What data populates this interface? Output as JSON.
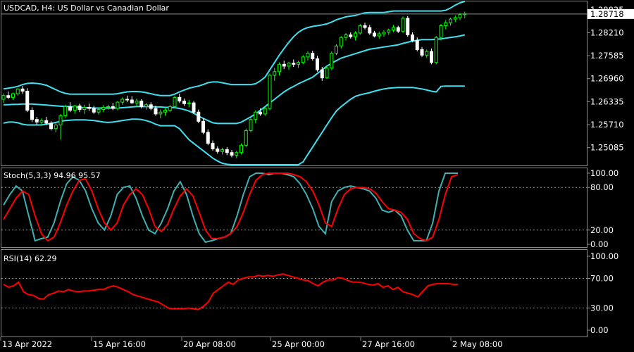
{
  "window": {
    "title": "USDCAD, H4:  US Dollar vs Canadian Dollar",
    "symbol": "USDCAD",
    "timeframe": "H4",
    "description": "US Dollar vs Canadian Dollar"
  },
  "colors": {
    "background": "#000000",
    "grid": "#8a8a8a",
    "bull_candle": "#00ff00",
    "bear_candle": "#ffffff",
    "bands": "#40e0f0",
    "stoch_main": "#40b0b0",
    "stoch_signal": "#ff0000",
    "rsi": "#ff0000",
    "price_tag_bg": "#ffffff",
    "price_tag_text": "#000000"
  },
  "chart_data": [
    {
      "type": "candlestick",
      "title": "USDCAD, H4:  US Dollar vs Canadian Dollar",
      "current_price": "1.28718",
      "price_levels": [
        "1.28835",
        "1.28210",
        "1.27585",
        "1.26960",
        "1.26335",
        "1.25710",
        "1.25085"
      ],
      "ylim": [
        1.246,
        1.2906
      ],
      "indicator": "Bollinger Bands",
      "candles": [
        [
          1.264,
          1.2656,
          1.263,
          1.265
        ],
        [
          1.265,
          1.2661,
          1.264,
          1.2645
        ],
        [
          1.2645,
          1.2658,
          1.2638,
          1.2655
        ],
        [
          1.2655,
          1.267,
          1.265,
          1.2668
        ],
        [
          1.2668,
          1.2676,
          1.2655,
          1.2662
        ],
        [
          1.2662,
          1.267,
          1.2605,
          1.261
        ],
        [
          1.261,
          1.2618,
          1.2578,
          1.2585
        ],
        [
          1.2585,
          1.2592,
          1.257,
          1.2578
        ],
        [
          1.2578,
          1.2588,
          1.2568,
          1.2582
        ],
        [
          1.2582,
          1.2592,
          1.257,
          1.2575
        ],
        [
          1.2575,
          1.258,
          1.2555,
          1.256
        ],
        [
          1.256,
          1.2575,
          1.255,
          1.257
        ],
        [
          1.257,
          1.26,
          1.253,
          1.2595
        ],
        [
          1.2595,
          1.2625,
          1.259,
          1.262
        ],
        [
          1.262,
          1.2632,
          1.2605,
          1.261
        ],
        [
          1.261,
          1.2625,
          1.26,
          1.2622
        ],
        [
          1.2622,
          1.2628,
          1.2605,
          1.2612
        ],
        [
          1.2612,
          1.2625,
          1.26,
          1.2618
        ],
        [
          1.2618,
          1.2628,
          1.2608,
          1.2615
        ],
        [
          1.2615,
          1.2622,
          1.26,
          1.2605
        ],
        [
          1.2605,
          1.2618,
          1.2598,
          1.2612
        ],
        [
          1.2612,
          1.2624,
          1.2605,
          1.2618
        ],
        [
          1.2618,
          1.2625,
          1.2612,
          1.262
        ],
        [
          1.262,
          1.263,
          1.261,
          1.2615
        ],
        [
          1.2615,
          1.2635,
          1.261,
          1.2632
        ],
        [
          1.2632,
          1.2645,
          1.2625,
          1.264
        ],
        [
          1.264,
          1.265,
          1.2632,
          1.2638
        ],
        [
          1.2638,
          1.2648,
          1.2628,
          1.263
        ],
        [
          1.263,
          1.2642,
          1.262,
          1.2635
        ],
        [
          1.2635,
          1.264,
          1.2615,
          1.262
        ],
        [
          1.262,
          1.263,
          1.2612,
          1.2625
        ],
        [
          1.2625,
          1.2632,
          1.261,
          1.2615
        ],
        [
          1.2615,
          1.2622,
          1.2595,
          1.26
        ],
        [
          1.26,
          1.2612,
          1.2588,
          1.2605
        ],
        [
          1.2605,
          1.2615,
          1.2595,
          1.261
        ],
        [
          1.261,
          1.2625,
          1.2605,
          1.262
        ],
        [
          1.262,
          1.265,
          1.2615,
          1.2645
        ],
        [
          1.2645,
          1.2655,
          1.263,
          1.2635
        ],
        [
          1.2635,
          1.2642,
          1.2622,
          1.2628
        ],
        [
          1.2628,
          1.2638,
          1.2618,
          1.263
        ],
        [
          1.263,
          1.2635,
          1.26,
          1.2605
        ],
        [
          1.2605,
          1.2612,
          1.2575,
          1.258
        ],
        [
          1.258,
          1.2588,
          1.2545,
          1.255
        ],
        [
          1.255,
          1.2558,
          1.2515,
          1.252
        ],
        [
          1.252,
          1.2528,
          1.25,
          1.2505
        ],
        [
          1.2505,
          1.2512,
          1.2492,
          1.2498
        ],
        [
          1.2498,
          1.2508,
          1.249,
          1.2503
        ],
        [
          1.2503,
          1.251,
          1.2488,
          1.2495
        ],
        [
          1.2495,
          1.2502,
          1.2482,
          1.2488
        ],
        [
          1.2488,
          1.25,
          1.248,
          1.2495
        ],
        [
          1.2495,
          1.252,
          1.249,
          1.2515
        ],
        [
          1.2515,
          1.256,
          1.251,
          1.2555
        ],
        [
          1.2555,
          1.259,
          1.255,
          1.2585
        ],
        [
          1.2585,
          1.261,
          1.2575,
          1.2605
        ],
        [
          1.2605,
          1.2615,
          1.2595,
          1.26
        ],
        [
          1.26,
          1.262,
          1.2595,
          1.2615
        ],
        [
          1.2615,
          1.271,
          1.261,
          1.2705
        ],
        [
          1.2705,
          1.2725,
          1.269,
          1.2715
        ],
        [
          1.2715,
          1.274,
          1.2705,
          1.2735
        ],
        [
          1.2735,
          1.2745,
          1.2722,
          1.273
        ],
        [
          1.273,
          1.2742,
          1.272,
          1.2738
        ],
        [
          1.2738,
          1.2748,
          1.2728,
          1.2735
        ],
        [
          1.2735,
          1.2745,
          1.2725,
          1.274
        ],
        [
          1.274,
          1.276,
          1.2735,
          1.2755
        ],
        [
          1.2755,
          1.277,
          1.2745,
          1.2765
        ],
        [
          1.2765,
          1.2772,
          1.2745,
          1.275
        ],
        [
          1.275,
          1.2758,
          1.2715,
          1.272
        ],
        [
          1.272,
          1.2728,
          1.269,
          1.2698
        ],
        [
          1.2698,
          1.273,
          1.2695,
          1.2725
        ],
        [
          1.2725,
          1.277,
          1.272,
          1.2765
        ],
        [
          1.2765,
          1.279,
          1.276,
          1.2785
        ],
        [
          1.2785,
          1.2812,
          1.2778,
          1.2808
        ],
        [
          1.2808,
          1.282,
          1.28,
          1.2815
        ],
        [
          1.2815,
          1.2822,
          1.2805,
          1.281
        ],
        [
          1.281,
          1.2825,
          1.28,
          1.282
        ],
        [
          1.282,
          1.2845,
          1.2815,
          1.284
        ],
        [
          1.284,
          1.2848,
          1.283,
          1.2835
        ],
        [
          1.2835,
          1.2842,
          1.2815,
          1.282
        ],
        [
          1.282,
          1.2826,
          1.2808,
          1.2812
        ],
        [
          1.2812,
          1.2824,
          1.2805,
          1.2818
        ],
        [
          1.2818,
          1.2828,
          1.281,
          1.2822
        ],
        [
          1.2822,
          1.2832,
          1.2815,
          1.2828
        ],
        [
          1.2828,
          1.2842,
          1.2822,
          1.2835
        ],
        [
          1.2835,
          1.284,
          1.282,
          1.2825
        ],
        [
          1.2825,
          1.2865,
          1.282,
          1.286
        ],
        [
          1.286,
          1.2866,
          1.281,
          1.2815
        ],
        [
          1.2815,
          1.2822,
          1.2795,
          1.28
        ],
        [
          1.28,
          1.2808,
          1.277,
          1.2775
        ],
        [
          1.2775,
          1.2782,
          1.2755,
          1.276
        ],
        [
          1.276,
          1.2775,
          1.2752,
          1.277
        ],
        [
          1.277,
          1.2778,
          1.2735,
          1.274
        ],
        [
          1.274,
          1.2812,
          1.2735,
          1.2808
        ],
        [
          1.2808,
          1.2845,
          1.28,
          1.284
        ],
        [
          1.284,
          1.2855,
          1.283,
          1.2848
        ],
        [
          1.2848,
          1.2862,
          1.284,
          1.2858
        ],
        [
          1.2858,
          1.2868,
          1.285,
          1.2862
        ],
        [
          1.2862,
          1.2875,
          1.2855,
          1.287
        ],
        [
          1.287,
          1.2878,
          1.286,
          1.2872
        ]
      ],
      "bands_upper": [
        1.2668,
        1.267,
        1.2672,
        1.2675,
        1.268,
        1.2683,
        1.2684,
        1.2683,
        1.2681,
        1.2678,
        1.2672,
        1.2666,
        1.266,
        1.2656,
        1.2654,
        1.2654,
        1.2654,
        1.2654,
        1.2654,
        1.2654,
        1.2654,
        1.2654,
        1.2654,
        1.2654,
        1.2655,
        1.2658,
        1.266,
        1.2661,
        1.2661,
        1.266,
        1.2658,
        1.2655,
        1.2652,
        1.265,
        1.265,
        1.265,
        1.2654,
        1.266,
        1.2665,
        1.267,
        1.2673,
        1.2676,
        1.268,
        1.2685,
        1.2687,
        1.2687,
        1.2685,
        1.2682,
        1.268,
        1.268,
        1.268,
        1.268,
        1.268,
        1.2682,
        1.269,
        1.27,
        1.272,
        1.274,
        1.276,
        1.2778,
        1.2795,
        1.281,
        1.2822,
        1.283,
        1.2835,
        1.2838,
        1.284,
        1.2842,
        1.2845,
        1.285,
        1.2856,
        1.286,
        1.2864,
        1.2866,
        1.2868,
        1.2872,
        1.2875,
        1.2876,
        1.2876,
        1.2876,
        1.2876,
        1.2878,
        1.288,
        1.288,
        1.288,
        1.288,
        1.288,
        1.288,
        1.288,
        1.288,
        1.288,
        1.288,
        1.288,
        1.2882,
        1.2888,
        1.2896,
        1.2902,
        1.2906
      ],
      "bands_middle": [
        1.2625,
        1.2625,
        1.2626,
        1.2626,
        1.2627,
        1.2627,
        1.2627,
        1.2626,
        1.2625,
        1.2624,
        1.2623,
        1.2622,
        1.2621,
        1.262,
        1.262,
        1.2619,
        1.2618,
        1.2617,
        1.2617,
        1.2616,
        1.2616,
        1.2616,
        1.2616,
        1.2616,
        1.2616,
        1.2617,
        1.2618,
        1.2619,
        1.262,
        1.262,
        1.262,
        1.262,
        1.2619,
        1.2619,
        1.2618,
        1.2618,
        1.2617,
        1.2615,
        1.2612,
        1.2608,
        1.2602,
        1.2594,
        1.2588,
        1.2582,
        1.2576,
        1.2574,
        1.2574,
        1.2574,
        1.2574,
        1.2574,
        1.2578,
        1.2585,
        1.2592,
        1.26,
        1.261,
        1.262,
        1.263,
        1.264,
        1.265,
        1.266,
        1.2668,
        1.2675,
        1.2682,
        1.2688,
        1.2694,
        1.27,
        1.271,
        1.272,
        1.273,
        1.2738,
        1.2745,
        1.2752,
        1.2756,
        1.276,
        1.2764,
        1.2768,
        1.2772,
        1.2776,
        1.2778,
        1.278,
        1.2782,
        1.2784,
        1.2786,
        1.2788,
        1.2792,
        1.2795,
        1.2798,
        1.28,
        1.2802,
        1.2802,
        1.2802,
        1.2803,
        1.2804,
        1.2806,
        1.2808,
        1.281,
        1.2812,
        1.2815
      ],
      "bands_lower": [
        1.2575,
        1.2578,
        1.2578,
        1.2576,
        1.2572,
        1.257,
        1.257,
        1.257,
        1.257,
        1.2572,
        1.2574,
        1.2577,
        1.258,
        1.2582,
        1.2583,
        1.2584,
        1.2584,
        1.2584,
        1.2583,
        1.2582,
        1.258,
        1.2578,
        1.2577,
        1.2578,
        1.258,
        1.2582,
        1.2584,
        1.2586,
        1.2586,
        1.2585,
        1.2582,
        1.2578,
        1.2572,
        1.2568,
        1.2568,
        1.2568,
        1.2568,
        1.256,
        1.2545,
        1.253,
        1.252,
        1.251,
        1.25,
        1.249,
        1.248,
        1.2472,
        1.2466,
        1.2463,
        1.2462,
        1.2462,
        1.2462,
        1.2462,
        1.2462,
        1.2462,
        1.2462,
        1.2462,
        1.2462,
        1.2462,
        1.2462,
        1.2462,
        1.2462,
        1.2462,
        1.2462,
        1.247,
        1.249,
        1.251,
        1.253,
        1.255,
        1.257,
        1.259,
        1.2608,
        1.262,
        1.263,
        1.264,
        1.2648,
        1.2652,
        1.2655,
        1.2658,
        1.2662,
        1.2665,
        1.2668,
        1.267,
        1.2671,
        1.2672,
        1.2672,
        1.2672,
        1.2672,
        1.267,
        1.2668,
        1.2665,
        1.2662,
        1.266,
        1.2675,
        1.2676,
        1.2676,
        1.2676,
        1.2676,
        1.2676
      ]
    },
    {
      "type": "line",
      "title": "Stoch(5,3,3) 94.96 95.57",
      "name": "Stoch(5,3,3)",
      "value_main": "94.96",
      "value_signal": "95.57",
      "ylim": [
        0,
        100
      ],
      "tick_labels": [
        "100.00",
        "80.00",
        "20.00",
        "0.00"
      ],
      "levels": [
        80,
        20
      ],
      "main": [
        55,
        70,
        82,
        75,
        40,
        5,
        8,
        10,
        30,
        60,
        85,
        95,
        90,
        75,
        50,
        30,
        20,
        40,
        70,
        80,
        82,
        65,
        40,
        20,
        15,
        30,
        50,
        75,
        88,
        70,
        40,
        15,
        3,
        5,
        8,
        10,
        15,
        40,
        70,
        95,
        100,
        100,
        98,
        100,
        100,
        98,
        95,
        85,
        70,
        50,
        25,
        15,
        60,
        75,
        80,
        82,
        80,
        78,
        75,
        65,
        48,
        45,
        48,
        40,
        20,
        5,
        5,
        5,
        30,
        75,
        100,
        100,
        100
      ],
      "signal": [
        35,
        50,
        65,
        75,
        70,
        40,
        15,
        5,
        10,
        30,
        55,
        75,
        90,
        92,
        75,
        50,
        30,
        20,
        30,
        55,
        70,
        78,
        70,
        50,
        25,
        18,
        28,
        50,
        68,
        78,
        68,
        45,
        20,
        8,
        8,
        10,
        15,
        25,
        45,
        70,
        90,
        98,
        100,
        100,
        100,
        100,
        98,
        95,
        88,
        75,
        55,
        30,
        25,
        50,
        70,
        78,
        80,
        80,
        78,
        72,
        60,
        50,
        48,
        45,
        35,
        15,
        8,
        5,
        10,
        35,
        70,
        95,
        98
      ]
    },
    {
      "type": "line",
      "title": "RSI(14) 62.29",
      "name": "RSI(14)",
      "value": "62.29",
      "ylim": [
        0,
        100
      ],
      "tick_labels": [
        "100.00",
        "70.00",
        "30.00",
        "0.00"
      ],
      "levels": [
        70,
        30
      ],
      "values": [
        62,
        58,
        60,
        65,
        52,
        48,
        47,
        43,
        42,
        48,
        50,
        53,
        52,
        55,
        53,
        52,
        53,
        53,
        54,
        55,
        55,
        58,
        60,
        58,
        55,
        52,
        48,
        46,
        44,
        42,
        40,
        38,
        34,
        30,
        29,
        29,
        29,
        30,
        29,
        28,
        32,
        38,
        50,
        55,
        60,
        65,
        62,
        68,
        70,
        72,
        72,
        74,
        73,
        74,
        73,
        75,
        76,
        74,
        72,
        70,
        68,
        67,
        63,
        60,
        65,
        68,
        68,
        71,
        70,
        67,
        65,
        65,
        64,
        62,
        61,
        63,
        58,
        60,
        55,
        58,
        52,
        50,
        48,
        45,
        53,
        60,
        62,
        63,
        63,
        63,
        62,
        62
      ]
    }
  ],
  "x_axis": {
    "labels": [
      "13 Apr 2022",
      "15 Apr 16:00",
      "20 Apr 08:00",
      "25 Apr 00:00",
      "27 Apr 16:00",
      "2 May 08:00"
    ]
  }
}
